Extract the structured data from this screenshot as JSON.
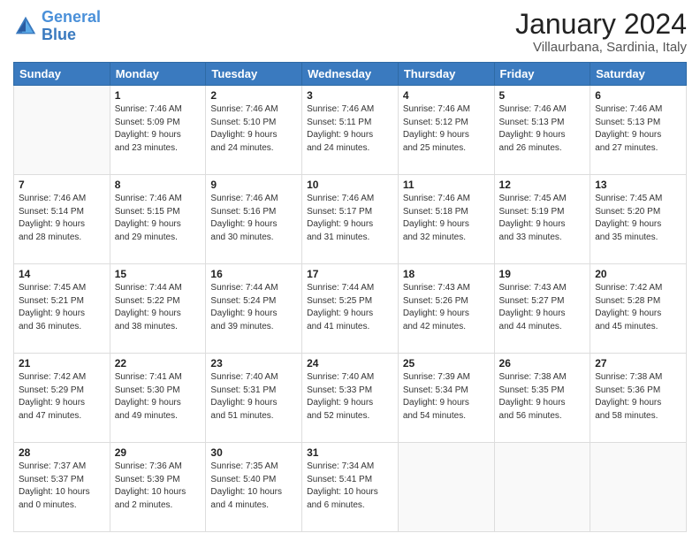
{
  "header": {
    "logo_line1": "General",
    "logo_line2": "Blue",
    "title": "January 2024",
    "subtitle": "Villaurbana, Sardinia, Italy"
  },
  "columns": [
    "Sunday",
    "Monday",
    "Tuesday",
    "Wednesday",
    "Thursday",
    "Friday",
    "Saturday"
  ],
  "weeks": [
    [
      {
        "day": "",
        "info": ""
      },
      {
        "day": "1",
        "info": "Sunrise: 7:46 AM\nSunset: 5:09 PM\nDaylight: 9 hours\nand 23 minutes."
      },
      {
        "day": "2",
        "info": "Sunrise: 7:46 AM\nSunset: 5:10 PM\nDaylight: 9 hours\nand 24 minutes."
      },
      {
        "day": "3",
        "info": "Sunrise: 7:46 AM\nSunset: 5:11 PM\nDaylight: 9 hours\nand 24 minutes."
      },
      {
        "day": "4",
        "info": "Sunrise: 7:46 AM\nSunset: 5:12 PM\nDaylight: 9 hours\nand 25 minutes."
      },
      {
        "day": "5",
        "info": "Sunrise: 7:46 AM\nSunset: 5:13 PM\nDaylight: 9 hours\nand 26 minutes."
      },
      {
        "day": "6",
        "info": "Sunrise: 7:46 AM\nSunset: 5:13 PM\nDaylight: 9 hours\nand 27 minutes."
      }
    ],
    [
      {
        "day": "7",
        "info": "Sunrise: 7:46 AM\nSunset: 5:14 PM\nDaylight: 9 hours\nand 28 minutes."
      },
      {
        "day": "8",
        "info": "Sunrise: 7:46 AM\nSunset: 5:15 PM\nDaylight: 9 hours\nand 29 minutes."
      },
      {
        "day": "9",
        "info": "Sunrise: 7:46 AM\nSunset: 5:16 PM\nDaylight: 9 hours\nand 30 minutes."
      },
      {
        "day": "10",
        "info": "Sunrise: 7:46 AM\nSunset: 5:17 PM\nDaylight: 9 hours\nand 31 minutes."
      },
      {
        "day": "11",
        "info": "Sunrise: 7:46 AM\nSunset: 5:18 PM\nDaylight: 9 hours\nand 32 minutes."
      },
      {
        "day": "12",
        "info": "Sunrise: 7:45 AM\nSunset: 5:19 PM\nDaylight: 9 hours\nand 33 minutes."
      },
      {
        "day": "13",
        "info": "Sunrise: 7:45 AM\nSunset: 5:20 PM\nDaylight: 9 hours\nand 35 minutes."
      }
    ],
    [
      {
        "day": "14",
        "info": "Sunrise: 7:45 AM\nSunset: 5:21 PM\nDaylight: 9 hours\nand 36 minutes."
      },
      {
        "day": "15",
        "info": "Sunrise: 7:44 AM\nSunset: 5:22 PM\nDaylight: 9 hours\nand 38 minutes."
      },
      {
        "day": "16",
        "info": "Sunrise: 7:44 AM\nSunset: 5:24 PM\nDaylight: 9 hours\nand 39 minutes."
      },
      {
        "day": "17",
        "info": "Sunrise: 7:44 AM\nSunset: 5:25 PM\nDaylight: 9 hours\nand 41 minutes."
      },
      {
        "day": "18",
        "info": "Sunrise: 7:43 AM\nSunset: 5:26 PM\nDaylight: 9 hours\nand 42 minutes."
      },
      {
        "day": "19",
        "info": "Sunrise: 7:43 AM\nSunset: 5:27 PM\nDaylight: 9 hours\nand 44 minutes."
      },
      {
        "day": "20",
        "info": "Sunrise: 7:42 AM\nSunset: 5:28 PM\nDaylight: 9 hours\nand 45 minutes."
      }
    ],
    [
      {
        "day": "21",
        "info": "Sunrise: 7:42 AM\nSunset: 5:29 PM\nDaylight: 9 hours\nand 47 minutes."
      },
      {
        "day": "22",
        "info": "Sunrise: 7:41 AM\nSunset: 5:30 PM\nDaylight: 9 hours\nand 49 minutes."
      },
      {
        "day": "23",
        "info": "Sunrise: 7:40 AM\nSunset: 5:31 PM\nDaylight: 9 hours\nand 51 minutes."
      },
      {
        "day": "24",
        "info": "Sunrise: 7:40 AM\nSunset: 5:33 PM\nDaylight: 9 hours\nand 52 minutes."
      },
      {
        "day": "25",
        "info": "Sunrise: 7:39 AM\nSunset: 5:34 PM\nDaylight: 9 hours\nand 54 minutes."
      },
      {
        "day": "26",
        "info": "Sunrise: 7:38 AM\nSunset: 5:35 PM\nDaylight: 9 hours\nand 56 minutes."
      },
      {
        "day": "27",
        "info": "Sunrise: 7:38 AM\nSunset: 5:36 PM\nDaylight: 9 hours\nand 58 minutes."
      }
    ],
    [
      {
        "day": "28",
        "info": "Sunrise: 7:37 AM\nSunset: 5:37 PM\nDaylight: 10 hours\nand 0 minutes."
      },
      {
        "day": "29",
        "info": "Sunrise: 7:36 AM\nSunset: 5:39 PM\nDaylight: 10 hours\nand 2 minutes."
      },
      {
        "day": "30",
        "info": "Sunrise: 7:35 AM\nSunset: 5:40 PM\nDaylight: 10 hours\nand 4 minutes."
      },
      {
        "day": "31",
        "info": "Sunrise: 7:34 AM\nSunset: 5:41 PM\nDaylight: 10 hours\nand 6 minutes."
      },
      {
        "day": "",
        "info": ""
      },
      {
        "day": "",
        "info": ""
      },
      {
        "day": "",
        "info": ""
      }
    ]
  ]
}
